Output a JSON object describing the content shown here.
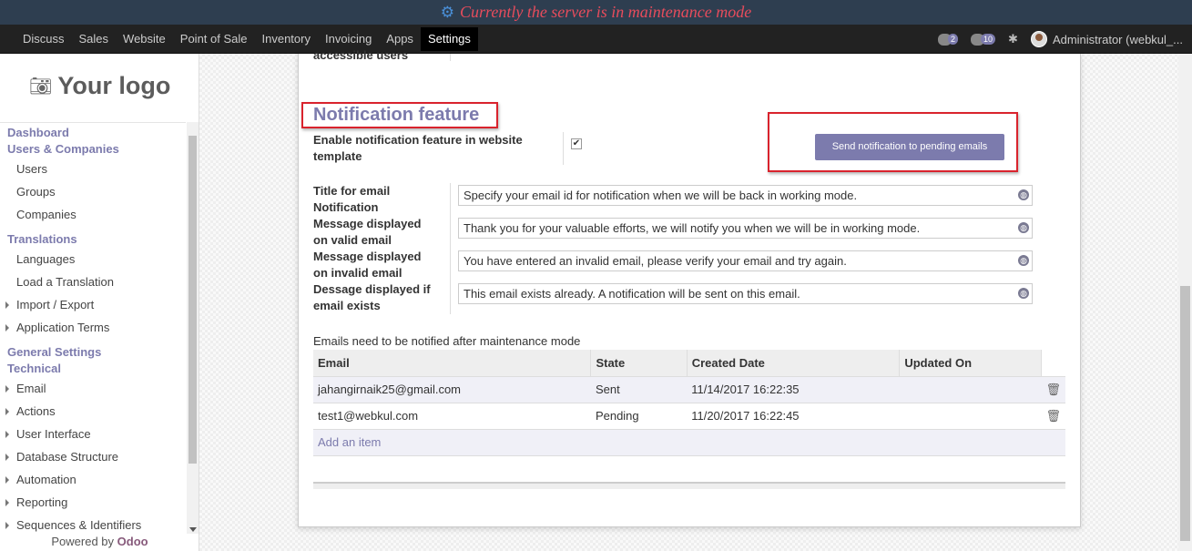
{
  "banner": {
    "text": "Currently the server is in maintenance mode"
  },
  "topnav": {
    "menu": [
      "Discuss",
      "Sales",
      "Website",
      "Point of Sale",
      "Inventory",
      "Invoicing",
      "Apps",
      "Settings"
    ],
    "active": "Settings",
    "chat_badge": "2",
    "messages_badge": "10",
    "user": "Administrator (webkul_..."
  },
  "sidebar": {
    "logo_text": "Your logo",
    "items": [
      {
        "type": "section",
        "label": "Dashboard"
      },
      {
        "type": "section",
        "label": "Users & Companies"
      },
      {
        "type": "item",
        "label": "Users"
      },
      {
        "type": "item",
        "label": "Groups"
      },
      {
        "type": "item",
        "label": "Companies"
      },
      {
        "type": "section",
        "label": "Translations"
      },
      {
        "type": "item",
        "label": "Languages"
      },
      {
        "type": "item",
        "label": "Load a Translation"
      },
      {
        "type": "expand",
        "label": "Import / Export"
      },
      {
        "type": "expand",
        "label": "Application Terms"
      },
      {
        "type": "section",
        "label": "General Settings"
      },
      {
        "type": "section",
        "label": "Technical"
      },
      {
        "type": "expand",
        "label": "Email"
      },
      {
        "type": "expand",
        "label": "Actions"
      },
      {
        "type": "expand",
        "label": "User Interface"
      },
      {
        "type": "expand",
        "label": "Database Structure"
      },
      {
        "type": "expand",
        "label": "Automation"
      },
      {
        "type": "expand",
        "label": "Reporting"
      },
      {
        "type": "expand",
        "label": "Sequences & Identifiers"
      }
    ],
    "powered_by": "Powered by",
    "powered_brand": "Odoo"
  },
  "form": {
    "cut_label": "accessible users",
    "section_title": "Notification feature",
    "enable_label_1": "Enable notification feature in website",
    "enable_label_2": "template",
    "enable_checked": true,
    "send_button": "Send notification to pending emails",
    "fields": [
      {
        "label_1": "Title for email",
        "label_2": "Notification",
        "value": "Specify your email id for notification when we will be back in working mode."
      },
      {
        "label_1": "Message displayed",
        "label_2": "on valid email",
        "value": "Thank you for your valuable efforts, we will notify you when we will be in working mode."
      },
      {
        "label_1": "Message displayed",
        "label_2": "on invalid email",
        "value": "You have entered an invalid email, please verify your email and try again."
      },
      {
        "label_1": "Dessage displayed if",
        "label_2": "email exists",
        "value": "This email exists already. A notification will be sent on this email."
      }
    ],
    "table_caption": "Emails need to be notified after maintenance mode",
    "columns": [
      "Email",
      "State",
      "Created Date",
      "Updated On"
    ],
    "rows": [
      {
        "email": "jahangirnaik25@gmail.com",
        "state": "Sent",
        "created": "11/14/2017 16:22:35",
        "updated": ""
      },
      {
        "email": "test1@webkul.com",
        "state": "Pending",
        "created": "11/20/2017 16:22:45",
        "updated": ""
      }
    ],
    "add_item": "Add an item"
  },
  "colors": {
    "accent": "#7c7bad",
    "highlight_red": "#d9232d",
    "banner_bg": "#2e3e50",
    "banner_text": "#e74c5c"
  }
}
